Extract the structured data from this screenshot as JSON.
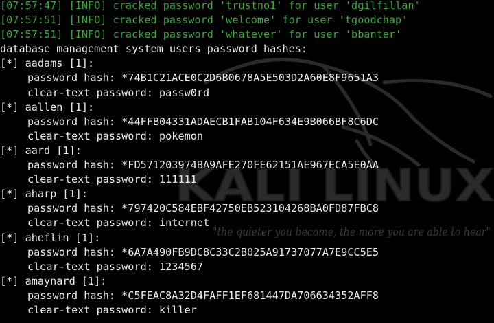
{
  "terminal": {
    "log_lines": [
      "[07:57:47] [INFO] cracked password 'trustno1' for user 'dgilfillan'",
      "[07:57:51] [INFO] cracked password 'welcome' for user 'tgoodchap'",
      "[07:57:51] [INFO] cracked password 'whatever' for user 'bbanter'"
    ],
    "section_header": "database management system users password hashes:",
    "users": [
      {
        "header": "[*] aadams [1]:",
        "hash": "password hash: *74B1C21ACE0C2D6B0678A5E503D2A60E8F9651A3",
        "clear": "clear-text password: passw0rd"
      },
      {
        "header": "[*] aallen [1]:",
        "hash": "password hash: *44FFB04331ADAECB1FAB104F634E9B066BF8C6DC",
        "clear": "clear-text password: pokemon"
      },
      {
        "header": "[*] aard [1]:",
        "hash": "password hash: *FD571203974BA9AFE270FE62151AE967ECA5E0AA",
        "clear": "clear-text password: 111111"
      },
      {
        "header": "[*] aharp [1]:",
        "hash": "password hash: *797420C584EBF42750EB523104268BA0FD87FBC8",
        "clear": "clear-text password: internet"
      },
      {
        "header": "[*] aheflin [1]:",
        "hash": "password hash: *6A7A490FB9DC8C33C2B025A91737077A7E9CC5E5",
        "clear": "clear-text password: 1234567"
      },
      {
        "header": "[*] amaynard [1]:",
        "hash": "password hash: *C5FEAC8A32D4FAFF1EF681447DA706634352AFF8",
        "clear": "clear-text password: killer"
      }
    ]
  },
  "watermark": {
    "logo_text": "KALI LINUX",
    "tagline": "\"the quieter you become, the more you are able to hear\""
  },
  "colors": {
    "background": "#000000",
    "log_text": "#3aa63a",
    "output_text": "#e8e8e8",
    "watermark": "#2e2e2e"
  }
}
